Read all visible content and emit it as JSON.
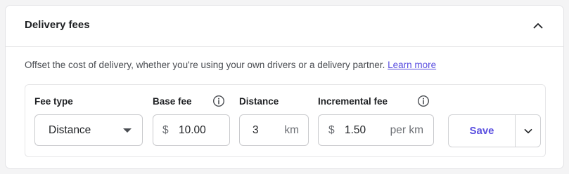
{
  "card": {
    "title": "Delivery fees",
    "collapse_icon": "chevron-up-icon",
    "description": "Offset the cost of delivery, whether you're using your own drivers or a delivery partner.",
    "learn_more": "Learn more"
  },
  "fee_type": {
    "label": "Fee type",
    "selected": "Distance"
  },
  "base_fee": {
    "label": "Base fee",
    "info_icon": "info-icon",
    "prefix": "$",
    "value": "10.00"
  },
  "distance": {
    "label": "Distance",
    "value": "3",
    "unit": "km"
  },
  "incremental_fee": {
    "label": "Incremental fee",
    "info_icon": "info-icon",
    "prefix": "$",
    "value": "1.50",
    "unit": "per km"
  },
  "actions": {
    "save_label": "Save",
    "more_icon": "chevron-down-icon"
  },
  "colors": {
    "accent": "#5a4fe0",
    "border": "#c9cacd",
    "background": "#f4f4f5"
  }
}
